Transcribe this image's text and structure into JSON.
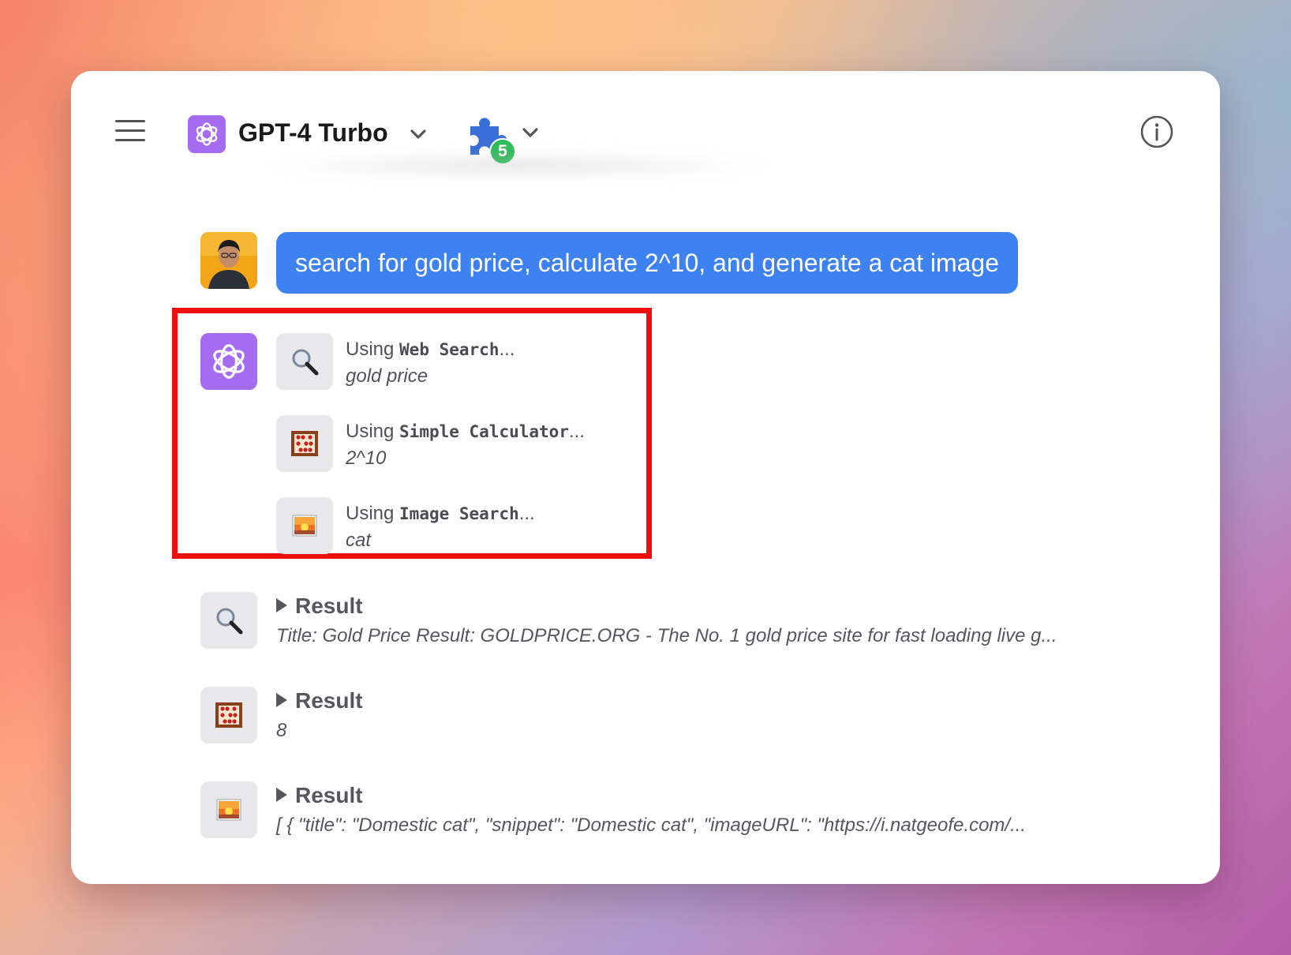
{
  "header": {
    "model_name": "GPT-4 Turbo",
    "plugin_count": "5"
  },
  "conversation": {
    "user_message": "search for gold price, calculate 2^10, and generate a cat image",
    "tool_calls": [
      {
        "prefix": "Using ",
        "tool_name": "Web Search",
        "suffix": "...",
        "query": "gold price",
        "icon": "magnifying-glass-icon"
      },
      {
        "prefix": "Using ",
        "tool_name": "Simple Calculator",
        "suffix": "...",
        "query": "2^10",
        "icon": "abacus-icon"
      },
      {
        "prefix": "Using ",
        "tool_name": "Image Search",
        "suffix": "...",
        "query": "cat",
        "icon": "sunrise-image-icon"
      }
    ],
    "results": [
      {
        "label": "Result",
        "body": "Title: Gold Price Result: GOLDPRICE.ORG - The No. 1 gold price site for fast loading live g...",
        "icon": "magnifying-glass-icon"
      },
      {
        "label": "Result",
        "body": "8",
        "icon": "abacus-icon"
      },
      {
        "label": "Result",
        "body": "[ { \"title\": \"Domestic cat\", \"snippet\": \"Domestic cat\", \"imageURL\": \"https://i.natgeofe.com/...",
        "icon": "sunrise-image-icon"
      }
    ]
  },
  "colors": {
    "user_bubble": "#3d82f0",
    "model_logo_bg": "#a56cf2",
    "highlight_border": "#ef0e0e",
    "plugin_badge": "#2fbb5a"
  }
}
